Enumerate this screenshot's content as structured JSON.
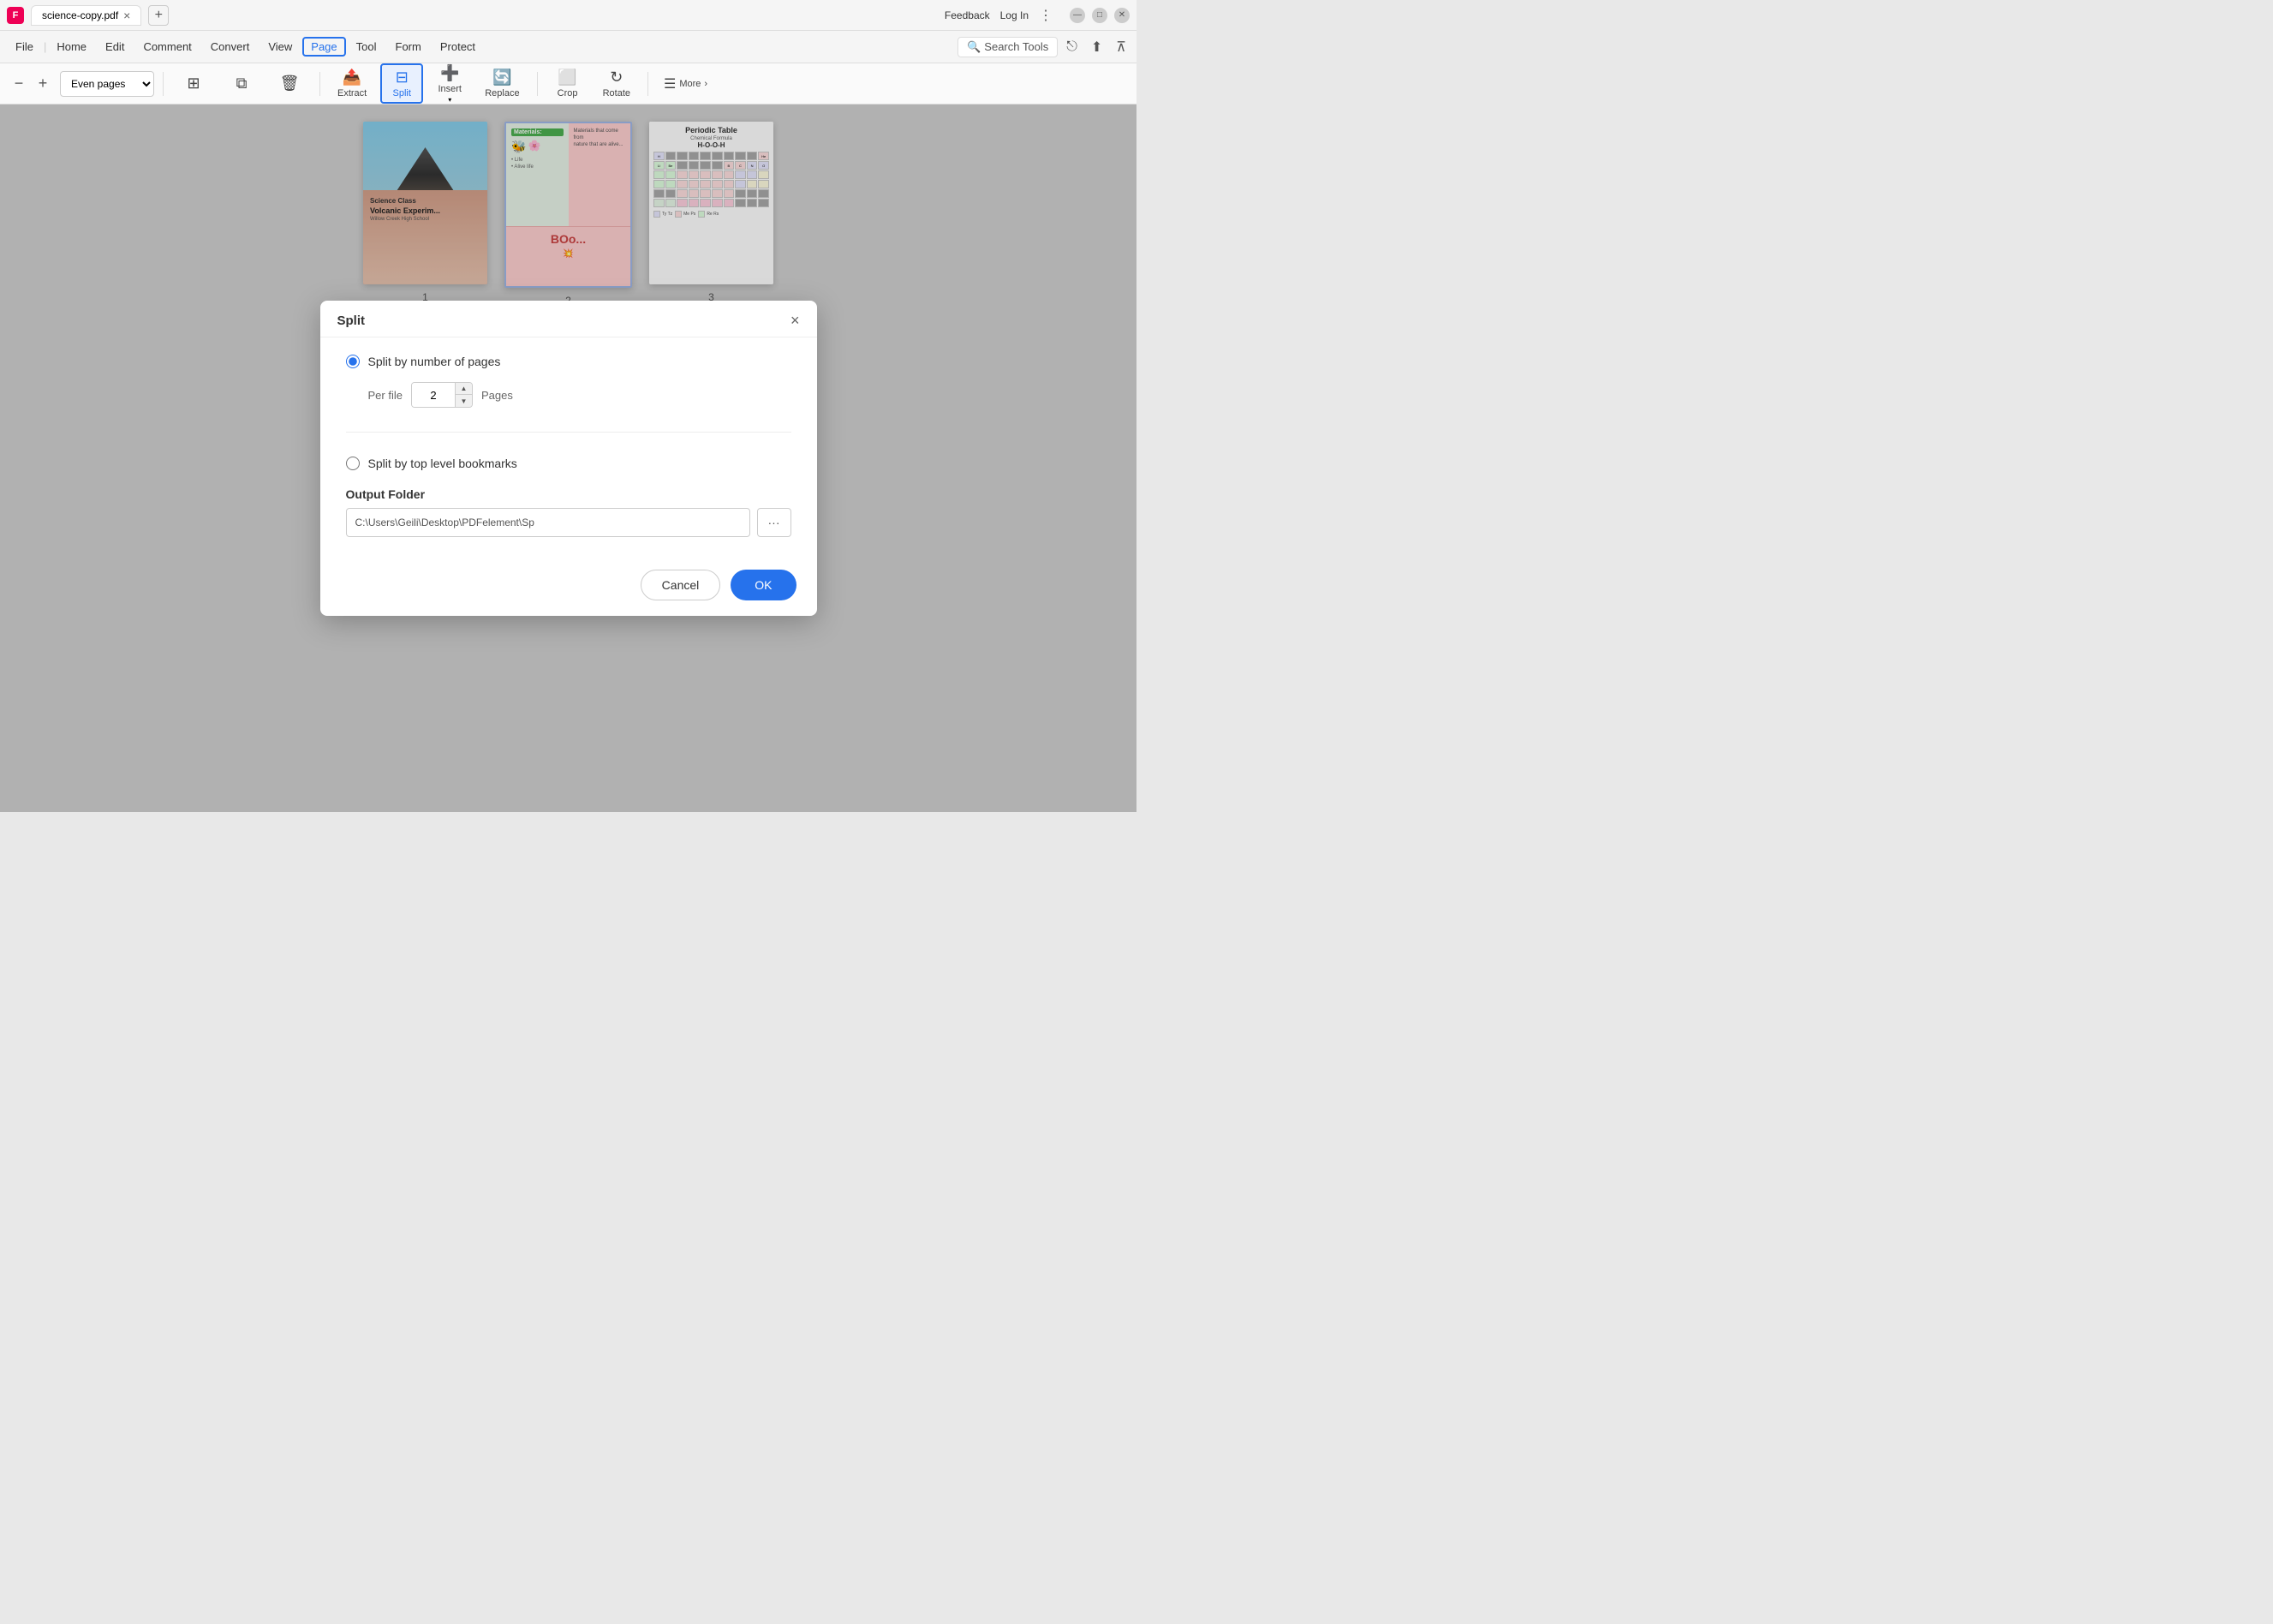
{
  "titlebar": {
    "app_icon_label": "F",
    "tab_title": "science-copy.pdf",
    "tab_close": "×",
    "tab_add": "+",
    "feedback": "Feedback",
    "login": "Log In",
    "win_minimize": "—",
    "win_maximize": "□",
    "win_close": "✕"
  },
  "menubar": {
    "file": "File",
    "home": "Home",
    "edit": "Edit",
    "comment": "Comment",
    "convert": "Convert",
    "view": "View",
    "page": "Page",
    "tool": "Tool",
    "form": "Form",
    "protect": "Protect",
    "search_tools": "Search Tools"
  },
  "toolbar": {
    "zoom_minus": "−",
    "zoom_plus": "+",
    "page_select_value": "Even pages",
    "extract": "Extract",
    "split": "Split",
    "insert": "Insert",
    "replace": "Replace",
    "crop": "Crop",
    "rotate": "Rotate",
    "more": "More",
    "more_arrow": "›"
  },
  "thumbnails": {
    "page1_number": "1",
    "page1_title": "Science Class",
    "page1_subtitle": "Volcanic Experim...",
    "page1_school": "Willow Creek High School",
    "page2_number": "2",
    "page2_materials": "Materials:",
    "page2_boo": "BOo...",
    "page3_number": "3",
    "page3_title": "Periodic Table",
    "page3_formula_label": "Chemical Formula",
    "page3_formula": "H-O-O-H"
  },
  "dialog": {
    "title": "Split",
    "close": "×",
    "option1_label": "Split by number of pages",
    "per_file_label": "Per file",
    "per_file_value": "2",
    "pages_label": "Pages",
    "option2_label": "Split by top level bookmarks",
    "output_folder_heading": "Output Folder",
    "folder_path": "C:\\Users\\Geili\\Desktop\\PDFelement\\Sp",
    "browse_btn": "···",
    "cancel_btn": "Cancel",
    "ok_btn": "OK"
  }
}
